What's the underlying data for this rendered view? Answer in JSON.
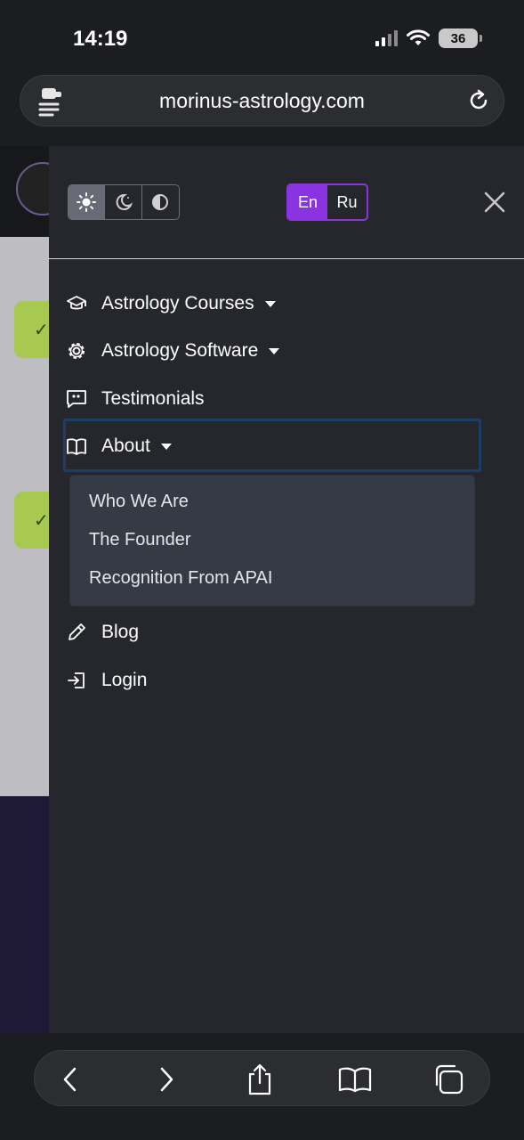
{
  "status_bar": {
    "time": "14:19",
    "battery": "36"
  },
  "browser": {
    "url": "morinus-astrology.com"
  },
  "theme_switch": {
    "options": [
      "light",
      "dark",
      "auto"
    ],
    "selected": "light"
  },
  "language": {
    "options": [
      "En",
      "Ru"
    ],
    "selected": "En"
  },
  "nav": {
    "items": [
      {
        "label": "Astrology Courses",
        "icon": "graduation-cap-icon",
        "has_dropdown": true
      },
      {
        "label": "Astrology Software",
        "icon": "gear-icon",
        "has_dropdown": true
      },
      {
        "label": "Testimonials",
        "icon": "quote-chat-icon",
        "has_dropdown": false
      },
      {
        "label": "About",
        "icon": "book-icon",
        "has_dropdown": true,
        "expanded": true
      },
      {
        "label": "Blog",
        "icon": "pencil-icon",
        "has_dropdown": false
      },
      {
        "label": "Login",
        "icon": "login-icon",
        "has_dropdown": false
      }
    ],
    "about_submenu": [
      "Who We Are",
      "The Founder",
      "Recognition From APAI"
    ]
  },
  "colors": {
    "accent": "#8a33e0",
    "drawer_bg": "#25272c",
    "submenu_bg": "#353a45",
    "focus_outline": "#1c3d66"
  }
}
